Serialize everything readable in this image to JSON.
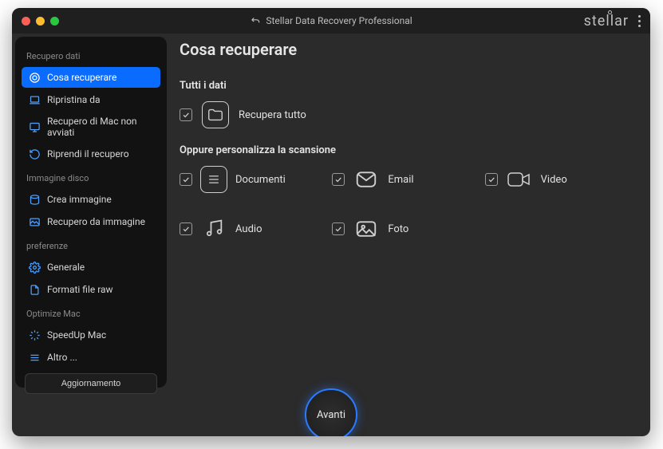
{
  "titlebar": {
    "app_title": "Stellar Data Recovery Professional",
    "brand": "stellar"
  },
  "sidebar": {
    "sections": [
      {
        "header": "Recupero dati",
        "items": [
          {
            "label": "Cosa recuperare",
            "icon": "target-icon",
            "active": true
          },
          {
            "label": "Ripristina da",
            "icon": "laptop-icon"
          },
          {
            "label": "Recupero di Mac non avviati",
            "icon": "screen-icon"
          },
          {
            "label": "Riprendi il recupero",
            "icon": "refresh-icon"
          }
        ]
      },
      {
        "header": "Immagine disco",
        "items": [
          {
            "label": "Crea immagine",
            "icon": "disk-icon"
          },
          {
            "label": "Recupero da immagine",
            "icon": "image-recover-icon"
          }
        ]
      },
      {
        "header": "preferenze",
        "items": [
          {
            "label": "Generale",
            "icon": "gear-icon"
          },
          {
            "label": "Formati file raw",
            "icon": "file-icon"
          }
        ]
      },
      {
        "header": "Optimize Mac",
        "items": [
          {
            "label": "SpeedUp Mac",
            "icon": "speed-icon"
          },
          {
            "label": "Altro ...",
            "icon": "menu-icon"
          }
        ]
      }
    ],
    "update_button": "Aggiornamento"
  },
  "main": {
    "heading": "Cosa recuperare",
    "section_all": "Tutti i dati",
    "recover_all": "Recupera tutto",
    "section_custom": "Oppure personalizza la scansione",
    "options": [
      {
        "label": "Documenti",
        "icon": "document-icon"
      },
      {
        "label": "Email",
        "icon": "email-icon"
      },
      {
        "label": "Video",
        "icon": "video-icon"
      },
      {
        "label": "Audio",
        "icon": "audio-icon"
      },
      {
        "label": "Foto",
        "icon": "photo-icon"
      }
    ],
    "next_button": "Avanti"
  }
}
